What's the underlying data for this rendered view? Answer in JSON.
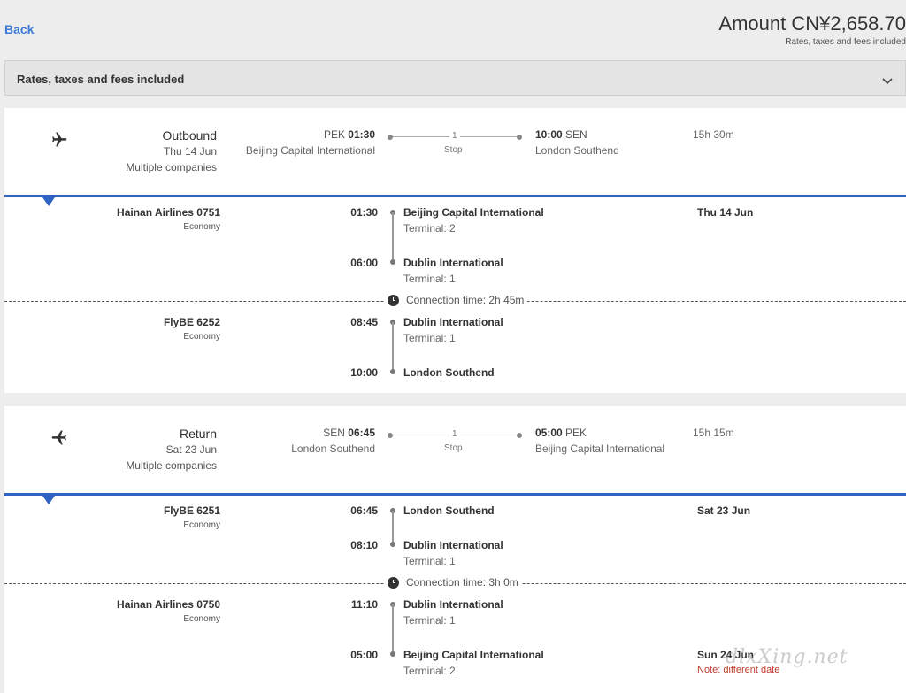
{
  "header": {
    "back_label": "Back",
    "amount": "Amount CN¥2,658.70",
    "amount_sub": "Rates, taxes and fees included"
  },
  "rates_bar": {
    "label": "Rates, taxes and fees included",
    "icon": "chevron-down-icon"
  },
  "outbound": {
    "title": "Outbound",
    "date": "Thu 14 Jun",
    "companies": "Multiple companies",
    "dep_code": "PEK",
    "dep_time": "01:30",
    "dep_name": "Beijing Capital International",
    "stops_count": "1",
    "stops_label": "Stop",
    "arr_time": "10:00",
    "arr_code": "SEN",
    "arr_name": "London Southend",
    "duration": "15h 30m",
    "segments": [
      {
        "flight": "Hainan Airlines 0751",
        "cabin": "Economy",
        "dep_time": "01:30",
        "dep_airport": "Beijing Capital International",
        "dep_terminal": "Terminal: 2",
        "date": "Thu 14 Jun",
        "arr_time": "06:00",
        "arr_airport": "Dublin International",
        "arr_terminal": "Terminal: 1"
      },
      {
        "flight": "FlyBE 6252",
        "cabin": "Economy",
        "dep_time": "08:45",
        "dep_airport": "Dublin International",
        "dep_terminal": "Terminal: 1",
        "arr_time": "10:00",
        "arr_airport": "London Southend"
      }
    ],
    "connection": "Connection time: 2h 45m"
  },
  "return": {
    "title": "Return",
    "date": "Sat 23 Jun",
    "companies": "Multiple companies",
    "dep_code": "SEN",
    "dep_time": "06:45",
    "dep_name": "London Southend",
    "stops_count": "1",
    "stops_label": "Stop",
    "arr_time": "05:00",
    "arr_code": "PEK",
    "arr_name": "Beijing Capital International",
    "duration": "15h 15m",
    "segments": [
      {
        "flight": "FlyBE 6251",
        "cabin": "Economy",
        "dep_time": "06:45",
        "dep_airport": "London Southend",
        "date": "Sat 23 Jun",
        "arr_time": "08:10",
        "arr_airport": "Dublin International",
        "arr_terminal": "Terminal: 1"
      },
      {
        "flight": "Hainan Airlines 0750",
        "cabin": "Economy",
        "dep_time": "11:10",
        "dep_airport": "Dublin International",
        "dep_terminal": "Terminal: 1",
        "arr_time": "05:00",
        "arr_airport": "Beijing Capital International",
        "arr_terminal": "Terminal: 2",
        "arr_date": "Sun 24 Jun",
        "arr_note": "Note: different date"
      }
    ],
    "connection": "Connection time: 3h 0m"
  },
  "watermark": "dlxXing.net",
  "colors": {
    "accent": "#2e63c2",
    "link": "#3d7bd6",
    "note": "#c0392b"
  }
}
